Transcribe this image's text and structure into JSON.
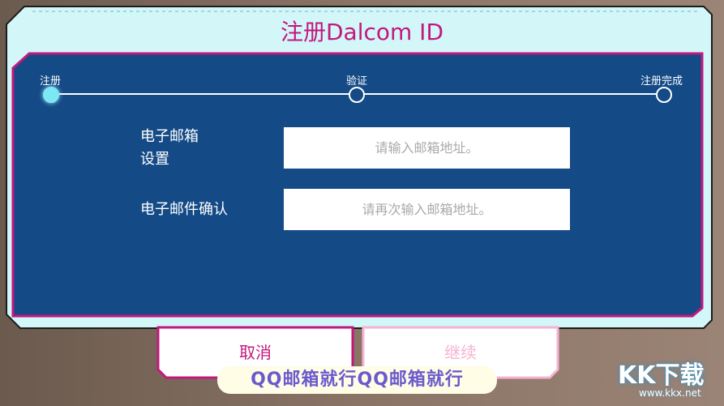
{
  "dialog": {
    "title": "注册Dalcom ID"
  },
  "stepper": {
    "steps": [
      {
        "label": "注册",
        "active": true
      },
      {
        "label": "验证",
        "active": false
      },
      {
        "label": "注册完成",
        "active": false
      }
    ]
  },
  "form": {
    "email": {
      "label_line1": "电子邮箱",
      "label_line2": "设置",
      "placeholder": "请输入邮箱地址。",
      "value": ""
    },
    "email_confirm": {
      "label": "电子邮件确认",
      "placeholder": "请再次输入邮箱地址。",
      "value": ""
    }
  },
  "buttons": {
    "cancel_label": "取消",
    "continue_label": "继续",
    "continue_enabled": false
  },
  "overlay": {
    "caption": "QQ邮箱就行QQ邮箱就行",
    "logo_text": "KK下载",
    "logo_url": "www.kkx.net"
  },
  "colors": {
    "frame_bg": "#d3f6f8",
    "panel_bg": "#144a86",
    "accent_pink": "#c2187e",
    "step_active": "#7de8f5",
    "button_disabled_text": "#f5b3d3"
  }
}
